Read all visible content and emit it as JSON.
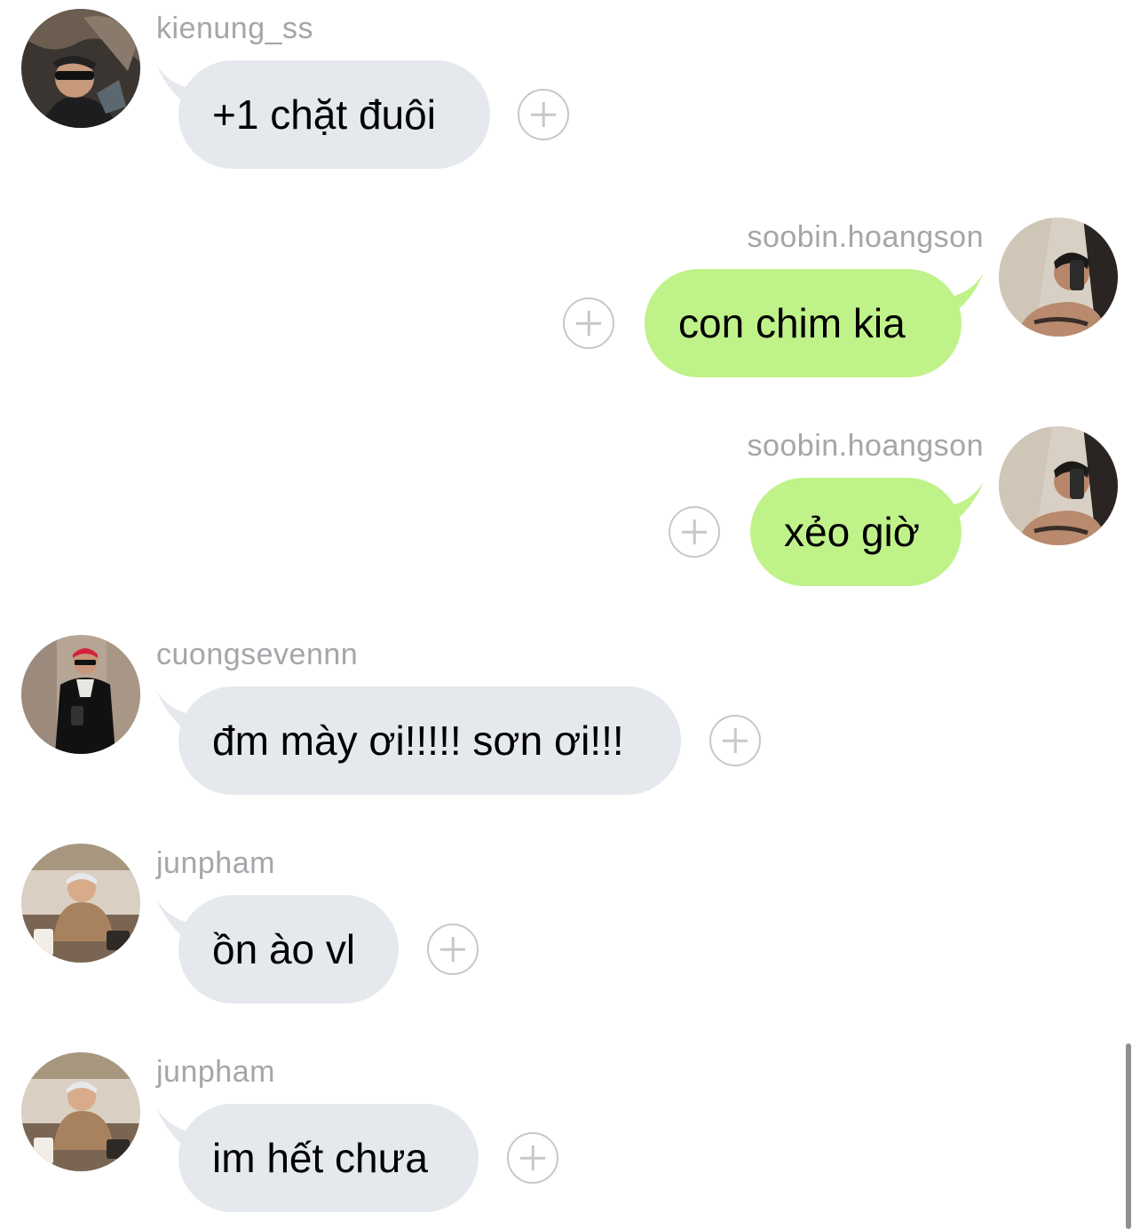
{
  "colors": {
    "incoming_bubble": "#e5e8ec",
    "outgoing_bubble": "#c0f28a",
    "username": "#a5a5aa",
    "react_icon": "#c7c7cc"
  },
  "messages": [
    {
      "username": "kienung_ss",
      "text": "+1 chặt đuôi",
      "direction": "incoming",
      "react_icon": "add-reaction-icon"
    },
    {
      "username": "soobin.hoangson",
      "text": "con chim kia",
      "direction": "outgoing",
      "react_icon": "add-reaction-icon"
    },
    {
      "username": "soobin.hoangson",
      "text": "xẻo giờ",
      "direction": "outgoing",
      "react_icon": "add-reaction-icon"
    },
    {
      "username": "cuongsevennn",
      "text": "đm mày ơi!!!!! sơn ơi!!!",
      "direction": "incoming",
      "react_icon": "add-reaction-icon"
    },
    {
      "username": "junpham",
      "text": "ồn ào vl",
      "direction": "incoming",
      "react_icon": "add-reaction-icon"
    },
    {
      "username": "junpham",
      "text": "im hết chưa",
      "direction": "incoming",
      "react_icon": "add-reaction-icon"
    }
  ]
}
